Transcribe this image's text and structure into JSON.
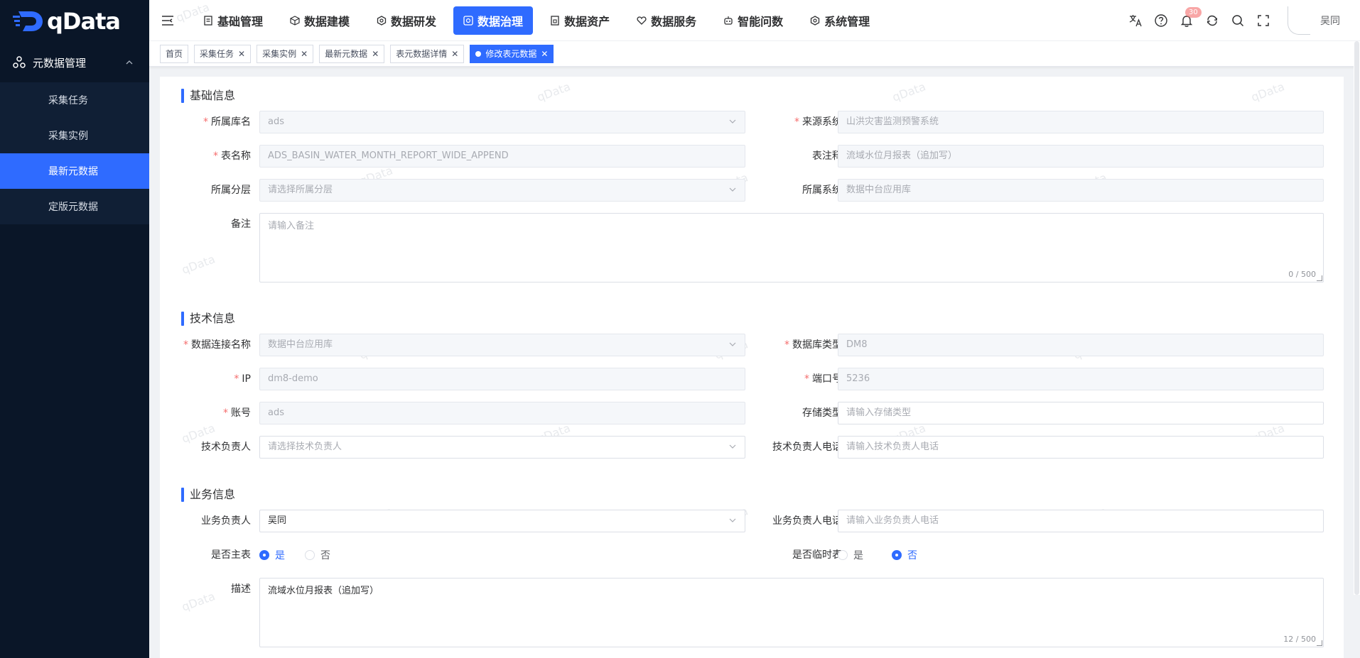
{
  "app": {
    "logo_text": "qData",
    "brand_color": "#2f6bff"
  },
  "sidebar": {
    "group": {
      "label": "元数据管理",
      "icon": "metadata-icon"
    },
    "items": [
      {
        "label": "采集任务",
        "active": false
      },
      {
        "label": "采集实例",
        "active": false
      },
      {
        "label": "最新元数据",
        "active": true
      },
      {
        "label": "定版元数据",
        "active": false
      }
    ]
  },
  "topnav": {
    "items": [
      {
        "label": "基础管理",
        "icon": "doc-icon"
      },
      {
        "label": "数据建模",
        "icon": "cube-icon"
      },
      {
        "label": "数据研发",
        "icon": "hexagon-icon"
      },
      {
        "label": "数据治理",
        "icon": "governance-icon",
        "active": true
      },
      {
        "label": "数据资产",
        "icon": "asset-icon"
      },
      {
        "label": "数据服务",
        "icon": "heart-icon"
      },
      {
        "label": "智能问数",
        "icon": "robot-icon"
      },
      {
        "label": "系统管理",
        "icon": "settings-icon"
      }
    ],
    "notification_count": "30",
    "user_name": "吴同"
  },
  "tabs": [
    {
      "label": "首页",
      "closable": false
    },
    {
      "label": "采集任务",
      "closable": true
    },
    {
      "label": "采集实例",
      "closable": true
    },
    {
      "label": "最新元数据",
      "closable": true
    },
    {
      "label": "表元数据详情",
      "closable": true
    },
    {
      "label": "修改表元数据",
      "closable": true,
      "active": true
    }
  ],
  "watermark": "qData",
  "basic": {
    "title": "基础信息",
    "db_name": {
      "label": "所属库名",
      "value": "ads"
    },
    "source_system": {
      "label": "来源系统",
      "value": "山洪灾害监测预警系统"
    },
    "table_name": {
      "label": "表名称",
      "value": "ADS_BASIN_WATER_MONTH_REPORT_WIDE_APPEND"
    },
    "table_comment": {
      "label": "表注释",
      "value": "流域水位月报表（追加写）"
    },
    "layer": {
      "label": "所属分层",
      "placeholder": "请选择所属分层"
    },
    "system": {
      "label": "所属系统",
      "value": "数据中台应用库"
    },
    "remark": {
      "label": "备注",
      "placeholder": "请输入备注",
      "counter": "0 / 500"
    }
  },
  "tech": {
    "title": "技术信息",
    "conn_name": {
      "label": "数据连接名称",
      "value": "数据中台应用库"
    },
    "db_type": {
      "label": "数据库类型",
      "value": "DM8"
    },
    "ip": {
      "label": "IP",
      "value": "dm8-demo"
    },
    "port": {
      "label": "端口号",
      "value": "5236"
    },
    "account": {
      "label": "账号",
      "value": "ads"
    },
    "storage_type": {
      "label": "存储类型",
      "placeholder": "请输入存储类型"
    },
    "owner": {
      "label": "技术负责人",
      "placeholder": "请选择技术负责人"
    },
    "owner_phone": {
      "label": "技术负责人电话",
      "placeholder": "请输入技术负责人电话"
    }
  },
  "biz": {
    "title": "业务信息",
    "owner": {
      "label": "业务负责人",
      "value": "吴同"
    },
    "owner_phone": {
      "label": "业务负责人电话",
      "placeholder": "请输入业务负责人电话"
    },
    "is_main": {
      "label": "是否主表",
      "yes": "是",
      "no": "否",
      "selected": "是"
    },
    "is_temp": {
      "label": "是否临时表",
      "yes": "是",
      "no": "否",
      "selected": "否"
    },
    "desc": {
      "label": "描述",
      "value": "流域水位月报表（追加写）",
      "counter": "12 / 500"
    }
  }
}
